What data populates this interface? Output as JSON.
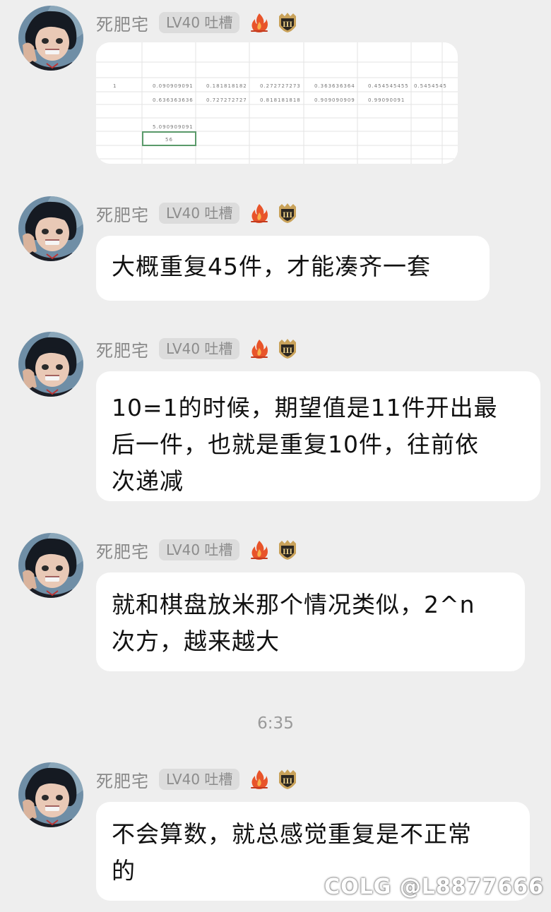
{
  "messages": [
    {
      "sender": "死肥宅",
      "level": "LV40 吐槽",
      "type": "image",
      "avatar": "avatar-icon",
      "badges": [
        "fire-icon",
        "rank-badge-icon"
      ],
      "sheet": {
        "rows": [
          [
            "1",
            "0.090909091",
            "0.181818182",
            "0.272727273",
            "0.363636364",
            "0.454545455",
            "0.5454545"
          ],
          [
            "",
            "0.636363636",
            "0.727272727",
            "0.818181818",
            "0.909090909",
            "0.99090091",
            ""
          ],
          [
            "",
            "",
            "",
            "",
            "",
            "",
            ""
          ],
          [
            "",
            "5.090909091",
            "",
            "",
            "",
            "",
            ""
          ],
          [
            "",
            "56",
            "",
            "",
            "",
            "",
            ""
          ]
        ]
      }
    },
    {
      "sender": "死肥宅",
      "level": "LV40 吐槽",
      "type": "text",
      "text": "大概重复45件，才能凑齐一套"
    },
    {
      "sender": "死肥宅",
      "level": "LV40 吐槽",
      "type": "text",
      "lines": [
        "10=1的时候，期望值是11件开出最",
        "后一件，也就是重复10件，往前依",
        "次递减"
      ]
    },
    {
      "sender": "死肥宅",
      "level": "LV40 吐槽",
      "type": "text",
      "lines": [
        "就和棋盘放米那个情况类似，2^n",
        "次方，越来越大"
      ]
    },
    {
      "sender": "死肥宅",
      "level": "LV40 吐槽",
      "type": "text",
      "lines": [
        "不会算数，就总感觉重复是不正常",
        "的"
      ]
    }
  ],
  "time_divider": "6:35",
  "watermark": "COLG @L8877666",
  "colors": {
    "background": "#eeeeee",
    "bubble": "#ffffff",
    "name": "#8a8a8a",
    "fire": "#e8542a",
    "badge_gold": "#c9a25a"
  }
}
